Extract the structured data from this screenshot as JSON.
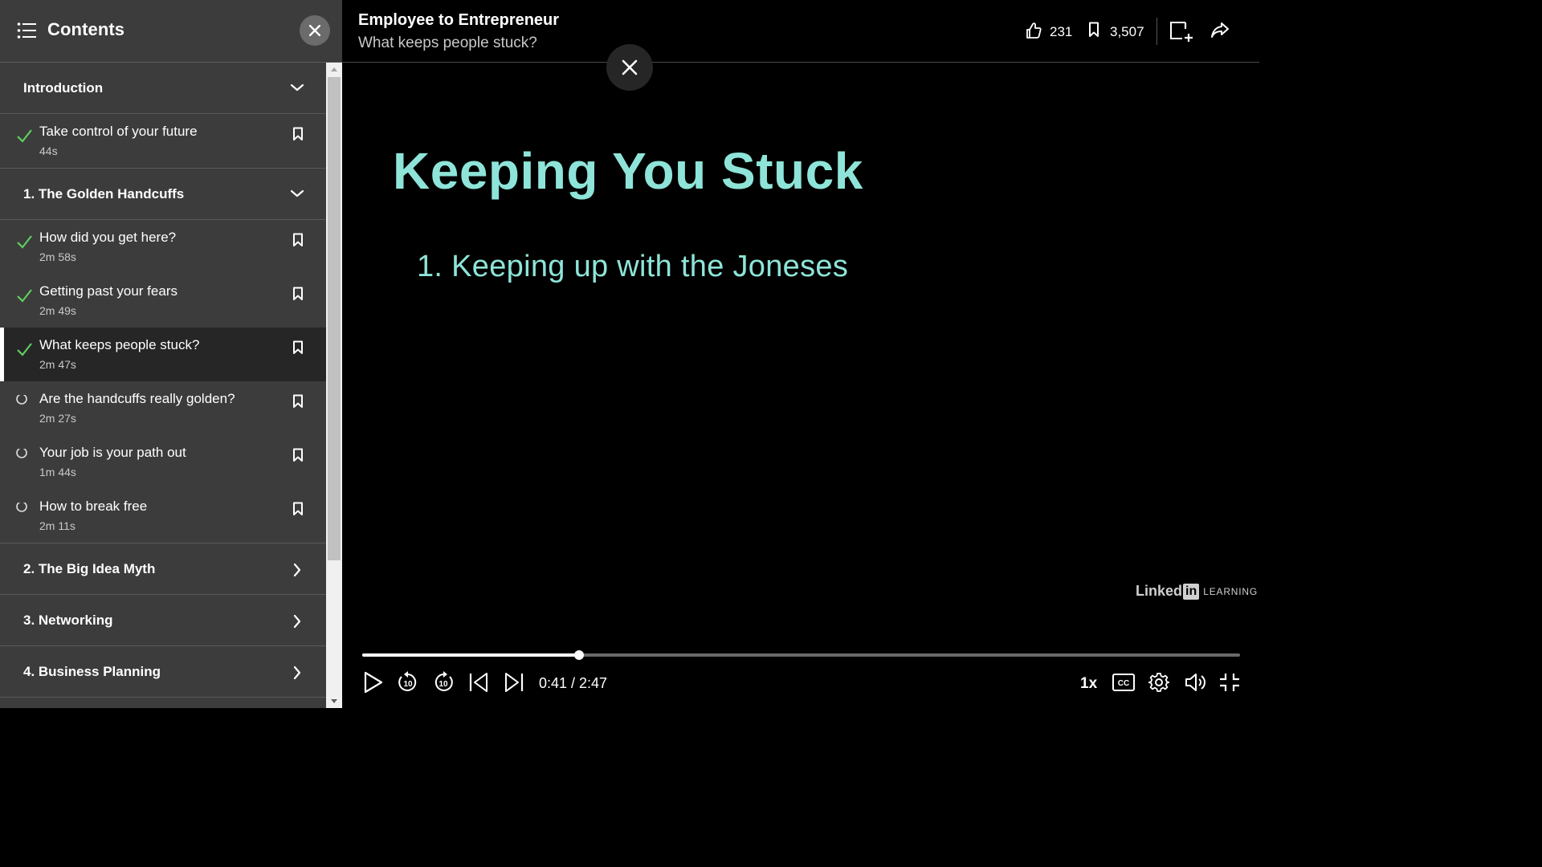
{
  "sidebar": {
    "title": "Contents",
    "sections": [
      {
        "title": "Introduction",
        "expanded": true,
        "items": [
          {
            "title": "Take control of your future",
            "duration": "44s",
            "status": "completed"
          }
        ]
      },
      {
        "title": "1. The Golden Handcuffs",
        "expanded": true,
        "items": [
          {
            "title": "How did you get here?",
            "duration": "2m 58s",
            "status": "completed"
          },
          {
            "title": "Getting past your fears",
            "duration": "2m 49s",
            "status": "completed"
          },
          {
            "title": "What keeps people stuck?",
            "duration": "2m 47s",
            "status": "completed",
            "active": true
          },
          {
            "title": "Are the handcuffs really golden?",
            "duration": "2m 27s",
            "status": "not-started"
          },
          {
            "title": "Your job is your path out",
            "duration": "1m 44s",
            "status": "not-started"
          },
          {
            "title": "How to break free",
            "duration": "2m 11s",
            "status": "not-started"
          }
        ]
      },
      {
        "title": "2. The Big Idea Myth",
        "expanded": false,
        "items": []
      },
      {
        "title": "3. Networking",
        "expanded": false,
        "items": []
      },
      {
        "title": "4. Business Planning",
        "expanded": false,
        "items": []
      }
    ]
  },
  "header": {
    "course_title": "Employee to Entrepreneur",
    "video_title": "What keeps people stuck?",
    "likes": "231",
    "saves": "3,507"
  },
  "slide": {
    "heading": "Keeping You Stuck",
    "bullet": "1. Keeping up with the Joneses",
    "watermark_linked": "Linked",
    "watermark_in": "in",
    "watermark_learning": "LEARNING"
  },
  "player": {
    "current_time": "0:41",
    "duration": "2:47",
    "time_display": "0:41 / 2:47",
    "progress_fraction": 0.247,
    "speed": "1x"
  },
  "colors": {
    "accent_check": "#5fcf5f",
    "slide_text": "#8ee4d8",
    "sidebar_bg": "#3c3c3c",
    "active_item_bg": "#262626"
  },
  "icons": {
    "sidebar_header": "list-icon",
    "close": "close-icon",
    "completed": "check-icon",
    "not_started": "circle-icon",
    "bookmark": "bookmark-icon",
    "expanded": "chevron-down-icon",
    "collapsed": "chevron-right-icon",
    "like": "thumbs-up-icon",
    "share": "share-icon",
    "add_to": "add-to-collection-icon"
  }
}
